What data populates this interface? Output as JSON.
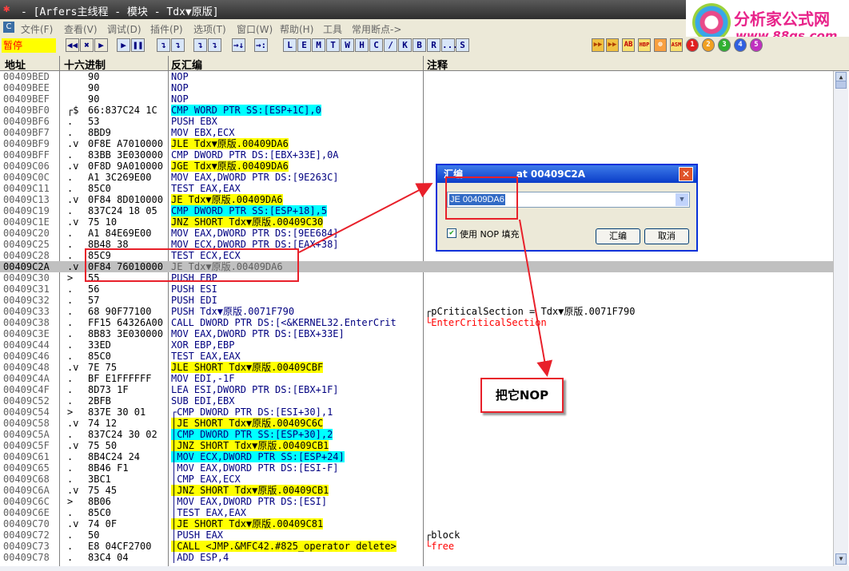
{
  "window": {
    "title": "- [Arfers主线程 - 模块 - Tdx▼原版]"
  },
  "logo": {
    "brand": "分析家公式网",
    "url": "www.88gs.com"
  },
  "menu": [
    "文件(F)",
    "查看(V)",
    "调试(D)",
    "插件(P)",
    "选项(T)",
    "窗口(W)",
    "帮助(H)",
    "工具",
    "常用断点->"
  ],
  "status": "暂停",
  "toolbar": {
    "left_buttons": [
      "◀◀",
      "✖",
      "▶",
      "❚❚",
      "↴",
      "↴",
      "↴",
      "↴",
      "→↓",
      "→:"
    ],
    "letter_buttons": [
      "L",
      "E",
      "M",
      "T",
      "W",
      "H",
      "C",
      "/",
      "K",
      "B",
      "R",
      "...",
      "S"
    ],
    "right_buttons": [
      "▶▶",
      "▶▶",
      "AB",
      "HBP",
      "⊕",
      "ASM",
      "1",
      "2",
      "3",
      "4",
      "5"
    ]
  },
  "columns": {
    "addr": "地址",
    "hex": "十六进制",
    "disasm": "反汇编",
    "comment": "注释"
  },
  "rows": [
    {
      "addr": "00409BED",
      "mk": "",
      "hex": "90",
      "asm": "NOP",
      "cmt": ""
    },
    {
      "addr": "00409BEE",
      "mk": "",
      "hex": "90",
      "asm": "NOP",
      "cmt": ""
    },
    {
      "addr": "00409BEF",
      "mk": "",
      "hex": "90",
      "asm": "NOP",
      "cmt": ""
    },
    {
      "addr": "00409BF0",
      "mk": "┌$",
      "hex": "66:837C24 1C",
      "asm": "CMP WORD PTR SS:[ESP+1C],0",
      "cmt": ""
    },
    {
      "addr": "00409BF6",
      "mk": ".",
      "hex": "53",
      "asm": "PUSH EBX",
      "cmt": ""
    },
    {
      "addr": "00409BF7",
      "mk": ".",
      "hex": "8BD9",
      "asm": "MOV EBX,ECX",
      "cmt": ""
    },
    {
      "addr": "00409BF9",
      "mk": ".v",
      "hex": "0F8E A7010000",
      "asm": "JLE Tdx▼原版.00409DA6",
      "cmt": ""
    },
    {
      "addr": "00409BFF",
      "mk": ".",
      "hex": "83BB 3E030000",
      "asm": "CMP DWORD PTR DS:[EBX+33E],0A",
      "cmt": ""
    },
    {
      "addr": "00409C06",
      "mk": ".v",
      "hex": "0F8D 9A010000",
      "asm": "JGE Tdx▼原版.00409DA6",
      "cmt": ""
    },
    {
      "addr": "00409C0C",
      "mk": ".",
      "hex": "A1 3C269E00",
      "asm": "MOV EAX,DWORD PTR DS:[9E263C]",
      "cmt": ""
    },
    {
      "addr": "00409C11",
      "mk": ".",
      "hex": "85C0",
      "asm": "TEST EAX,EAX",
      "cmt": ""
    },
    {
      "addr": "00409C13",
      "mk": ".v",
      "hex": "0F84 8D010000",
      "asm": "JE Tdx▼原版.00409DA6",
      "cmt": ""
    },
    {
      "addr": "00409C19",
      "mk": ".",
      "hex": "837C24 18 05",
      "asm": "CMP DWORD PTR SS:[ESP+18],5",
      "cmt": ""
    },
    {
      "addr": "00409C1E",
      "mk": ".v",
      "hex": "75 10",
      "asm": "JNZ SHORT Tdx▼原版.00409C30",
      "cmt": ""
    },
    {
      "addr": "00409C20",
      "mk": ".",
      "hex": "A1 84E69E00",
      "asm": "MOV EAX,DWORD PTR DS:[9EE684]",
      "cmt": ""
    },
    {
      "addr": "00409C25",
      "mk": ".",
      "hex": "8B48 38",
      "asm": "MOV ECX,DWORD PTR DS:[EAX+38]",
      "cmt": ""
    },
    {
      "addr": "00409C28",
      "mk": ".",
      "hex": "85C9",
      "asm": "TEST ECX,ECX",
      "cmt": ""
    },
    {
      "addr": "00409C2A",
      "mk": ".v",
      "hex": "0F84 76010000",
      "asm": "JE Tdx▼原版.00409DA6",
      "cmt": ""
    },
    {
      "addr": "00409C30",
      "mk": ">",
      "hex": "55",
      "asm": "PUSH EBP",
      "cmt": ""
    },
    {
      "addr": "00409C31",
      "mk": ".",
      "hex": "56",
      "asm": "PUSH ESI",
      "cmt": ""
    },
    {
      "addr": "00409C32",
      "mk": ".",
      "hex": "57",
      "asm": "PUSH EDI",
      "cmt": ""
    },
    {
      "addr": "00409C33",
      "mk": ".",
      "hex": "68 90F77100",
      "asm": "PUSH Tdx▼原版.0071F790",
      "cmt": "┌pCriticalSection = Tdx▼原版.0071F790"
    },
    {
      "addr": "00409C38",
      "mk": ".",
      "hex": "FF15 64326A00",
      "asm": "CALL DWORD PTR DS:[<&KERNEL32.EnterCrit",
      "cmt": "└EnterCriticalSection"
    },
    {
      "addr": "00409C3E",
      "mk": ".",
      "hex": "8B83 3E030000",
      "asm": "MOV EAX,DWORD PTR DS:[EBX+33E]",
      "cmt": ""
    },
    {
      "addr": "00409C44",
      "mk": ".",
      "hex": "33ED",
      "asm": "XOR EBP,EBP",
      "cmt": ""
    },
    {
      "addr": "00409C46",
      "mk": ".",
      "hex": "85C0",
      "asm": "TEST EAX,EAX",
      "cmt": ""
    },
    {
      "addr": "00409C48",
      "mk": ".v",
      "hex": "7E 75",
      "asm": "JLE SHORT Tdx▼原版.00409CBF",
      "cmt": ""
    },
    {
      "addr": "00409C4A",
      "mk": ".",
      "hex": "BF E1FFFFFF",
      "asm": "MOV EDI,-1F",
      "cmt": ""
    },
    {
      "addr": "00409C4F",
      "mk": ".",
      "hex": "8D73 1F",
      "asm": "LEA ESI,DWORD PTR DS:[EBX+1F]",
      "cmt": ""
    },
    {
      "addr": "00409C52",
      "mk": ".",
      "hex": "2BFB",
      "asm": "SUB EDI,EBX",
      "cmt": ""
    },
    {
      "addr": "00409C54",
      "mk": ">",
      "hex": "837E 30 01",
      "asm": "┌CMP DWORD PTR DS:[ESI+30],1",
      "cmt": ""
    },
    {
      "addr": "00409C58",
      "mk": ".v",
      "hex": "74 12",
      "asm": "│JE SHORT Tdx▼原版.00409C6C",
      "cmt": ""
    },
    {
      "addr": "00409C5A",
      "mk": ".",
      "hex": "837C24 30 02",
      "asm": "│CMP DWORD PTR SS:[ESP+30],2",
      "cmt": ""
    },
    {
      "addr": "00409C5F",
      "mk": ".v",
      "hex": "75 50",
      "asm": "│JNZ SHORT Tdx▼原版.00409CB1",
      "cmt": ""
    },
    {
      "addr": "00409C61",
      "mk": ".",
      "hex": "8B4C24 24",
      "asm": "│MOV ECX,DWORD PTR SS:[ESP+24]",
      "cmt": ""
    },
    {
      "addr": "00409C65",
      "mk": ".",
      "hex": "8B46 F1",
      "asm": "│MOV EAX,DWORD PTR DS:[ESI-F]",
      "cmt": ""
    },
    {
      "addr": "00409C68",
      "mk": ".",
      "hex": "3BC1",
      "asm": "│CMP EAX,ECX",
      "cmt": ""
    },
    {
      "addr": "00409C6A",
      "mk": ".v",
      "hex": "75 45",
      "asm": "│JNZ SHORT Tdx▼原版.00409CB1",
      "cmt": ""
    },
    {
      "addr": "00409C6C",
      "mk": ">",
      "hex": "8B06",
      "asm": "│MOV EAX,DWORD PTR DS:[ESI]",
      "cmt": ""
    },
    {
      "addr": "00409C6E",
      "mk": ".",
      "hex": "85C0",
      "asm": "│TEST EAX,EAX",
      "cmt": ""
    },
    {
      "addr": "00409C70",
      "mk": ".v",
      "hex": "74 0F",
      "asm": "│JE SHORT Tdx▼原版.00409C81",
      "cmt": ""
    },
    {
      "addr": "00409C72",
      "mk": ".",
      "hex": "50",
      "asm": "│PUSH EAX",
      "cmt": "┌block"
    },
    {
      "addr": "00409C73",
      "mk": ".",
      "hex": "E8 04CF2700",
      "asm": "│CALL <JMP.&MFC42.#825_operator delete>",
      "cmt": "└free"
    },
    {
      "addr": "00409C78",
      "mk": ".",
      "hex": "83C4 04",
      "asm": "│ADD ESP,4",
      "cmt": ""
    }
  ],
  "dialog": {
    "title": "汇编",
    "address": "00409C2A",
    "input_value": "JE 00409DA6",
    "nop_fill_label": "使用 NOP 填充",
    "nop_fill_checked": true,
    "assemble_button": "汇编",
    "cancel_button": "取消"
  },
  "annotation": {
    "callout": "把它NOP"
  },
  "colors": {
    "accent_red": "#e8202a",
    "jump_yellow": "#ffff00",
    "stack_cyan": "#00ffff",
    "asm_blue": "#000080"
  }
}
